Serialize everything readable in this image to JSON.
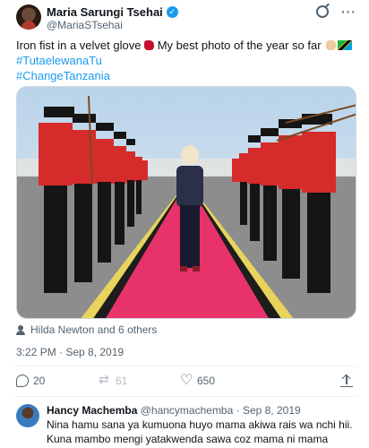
{
  "author": {
    "display_name": "Maria Sarungi Tsehai",
    "handle": "@MariaSTsehai"
  },
  "tweet": {
    "text_part1": "Iron fist in a velvet glove",
    "text_part2": "My best photo of the year so far",
    "hashtag1": "#TutaelewanaTu",
    "hashtag2": "#ChangeTanzania"
  },
  "tagged": "Hilda Newton and 6 others",
  "timestamp": "3:22 PM · Sep 8, 2019",
  "actions": {
    "replies": "20",
    "retweets": "61",
    "likes": "650"
  },
  "reply": {
    "name": "Hancy Machemba",
    "handle_date": "@hancymachemba · Sep 8, 2019",
    "text": "Nina hamu sana ya kumuona huyo mama akiwa rais wa nchi hii. Kuna mambo mengi yatakwenda sawa coz mama ni mama"
  },
  "icons": [
    "verified-badge-icon",
    "grok-icon",
    "more-icon",
    "person-icon",
    "reply-icon",
    "retweet-icon",
    "like-icon",
    "share-icon"
  ],
  "colors": {
    "accent": "#1d9bf0",
    "muted": "#536471",
    "carpet": "#e8336a",
    "uniform": "#d62b2b"
  }
}
